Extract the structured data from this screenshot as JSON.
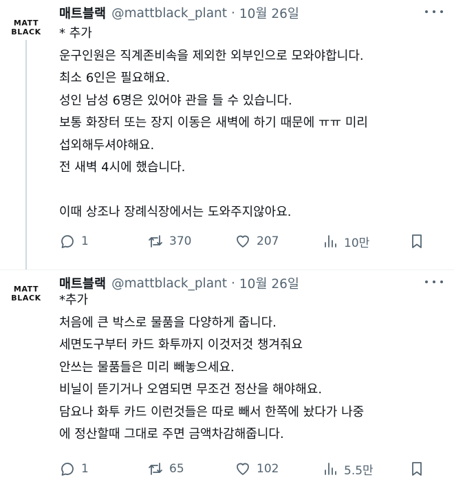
{
  "tweets": [
    {
      "avatar": {
        "line1": "MATT",
        "line2": "BLACK"
      },
      "display_name": "매트블랙",
      "handle": "@mattblack_plant",
      "separator": "·",
      "date": "10월 26일",
      "text": "* 추가\n운구인원은 직계존비속을 제외한 외부인으로 모와야합니다.\n최소 6인은 필요해요.\n성인 남성 6명은 있어야 관을 들 수 있습니다.\n보통 화장터 또는 장지 이동은 새벽에 하기 때문에 ㅠㅠ 미리\n섭외해두셔야해요.\n전 새벽 4시에 했습니다.\n\n이때 상조나 장례식장에서는 도와주지않아요.",
      "stats": {
        "replies": "1",
        "retweets": "370",
        "likes": "207",
        "views": "10만"
      }
    },
    {
      "avatar": {
        "line1": "MATT",
        "line2": "BLACK"
      },
      "display_name": "매트블랙",
      "handle": "@mattblack_plant",
      "separator": "·",
      "date": "10월 26일",
      "text": "*추가\n처음에 큰 박스로 물품을 다양하게 줍니다.\n세면도구부터 카드 화투까지 이것저것 챙겨줘요\n안쓰는 물품들은 미리 빼놓으세요.\n비닐이 뜯기거나 오염되면 무조건 정산을 해야해요.\n담요나 화투 카드 이런것들은 따로 빼서 한쪽에 놨다가 나중\n에 정산할때 그대로 주면 금액차감해줍니다.",
      "stats": {
        "replies": "1",
        "retweets": "65",
        "likes": "102",
        "views": "5.5만"
      }
    }
  ],
  "colors": {
    "text": "#0f1419",
    "secondary": "#536471",
    "thread_line": "#cfd9de",
    "divider": "#eff3f4"
  },
  "icons": [
    "reply-icon",
    "retweet-icon",
    "like-icon",
    "views-icon",
    "bookmark-icon",
    "more-icon"
  ]
}
